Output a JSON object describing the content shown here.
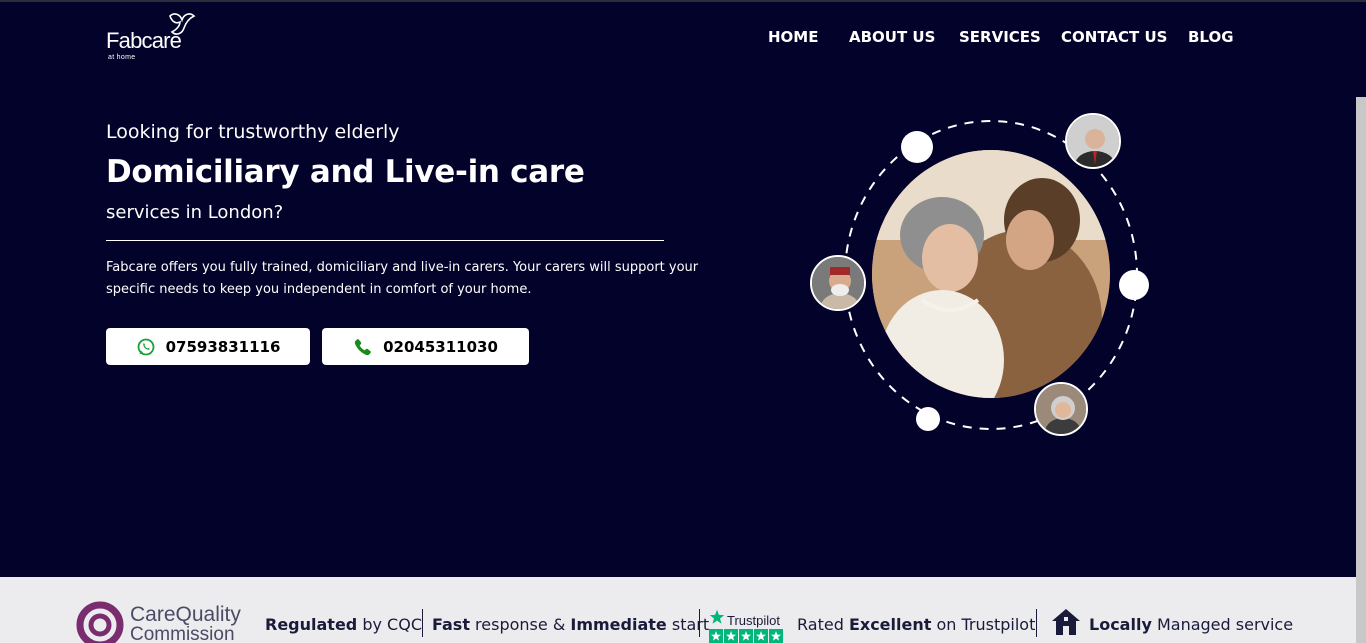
{
  "brand": {
    "name": "Fabcare",
    "tagline": "at home"
  },
  "nav": {
    "items": [
      {
        "label": "HOME"
      },
      {
        "label": "ABOUT US"
      },
      {
        "label": "SERVICES"
      },
      {
        "label": "CONTACT US"
      },
      {
        "label": "BLOG"
      }
    ]
  },
  "hero": {
    "intro": "Looking for trustworthy elderly",
    "headline": "Domiciliary and Live-in care",
    "sub": "services in London?",
    "description": "Fabcare offers you fully trained, domiciliary and live-in carers. Your carers will support your specific needs to keep you independent in comfort of your home.",
    "whatsapp_number": "07593831116",
    "phone_number": "02045311030"
  },
  "trust_bar": {
    "cqc_line1": "CareQuality",
    "cqc_line2": "Commission",
    "regulated_bold": "Regulated",
    "regulated_rest": " by CQC",
    "fast_bold": "Fast",
    "fast_mid": " response & ",
    "fast_bold2": "Immediate",
    "fast_rest": " start",
    "trustpilot_label": "Trustpilot",
    "rated_pre": "Rated ",
    "rated_bold": "Excellent",
    "rated_post": " on Trustpilot",
    "local_bold": "Locally",
    "local_rest": " Managed service"
  },
  "colors": {
    "background": "#03022a",
    "strip": "#ececee",
    "whatsapp_green": "#1f9e3c",
    "phone_green": "#1a8a1a",
    "cqc_purple": "#7a2d6e",
    "trustpilot_green": "#00b67a"
  },
  "icons": {
    "whatsapp": "whatsapp-icon",
    "phone": "phone-icon",
    "home": "home-icon",
    "star": "star-icon",
    "logo_bird": "bird-icon"
  }
}
